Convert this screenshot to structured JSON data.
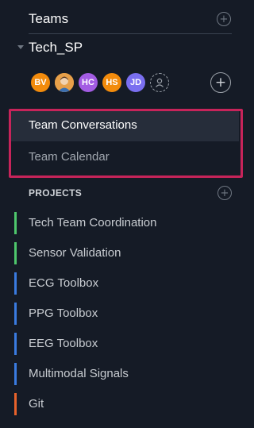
{
  "teams": {
    "title": "Teams"
  },
  "team": {
    "name": "Tech_SP"
  },
  "members": [
    {
      "initials": "BV",
      "color": "#f28b0c"
    },
    {
      "initials": "",
      "color": "#f28b0c",
      "photo": true
    },
    {
      "initials": "HC",
      "color": "#a35ce3"
    },
    {
      "initials": "HS",
      "color": "#f28b0c"
    },
    {
      "initials": "JD",
      "color": "#7a6ff0"
    }
  ],
  "nav": {
    "conversations": "Team Conversations",
    "calendar": "Team Calendar"
  },
  "projects": {
    "title": "PROJECTS",
    "items": [
      {
        "label": "Tech Team Coordination",
        "color": "#4ec76c"
      },
      {
        "label": "Sensor Validation",
        "color": "#4ec76c"
      },
      {
        "label": "ECG Toolbox",
        "color": "#3a7be0"
      },
      {
        "label": "PPG Toolbox",
        "color": "#3a7be0"
      },
      {
        "label": "EEG Toolbox",
        "color": "#3a7be0"
      },
      {
        "label": "Multimodal Signals",
        "color": "#3a7be0"
      },
      {
        "label": "Git",
        "color": "#e8622b"
      }
    ]
  },
  "colors": {
    "background": "#151b26",
    "highlight": "#c7245a"
  }
}
